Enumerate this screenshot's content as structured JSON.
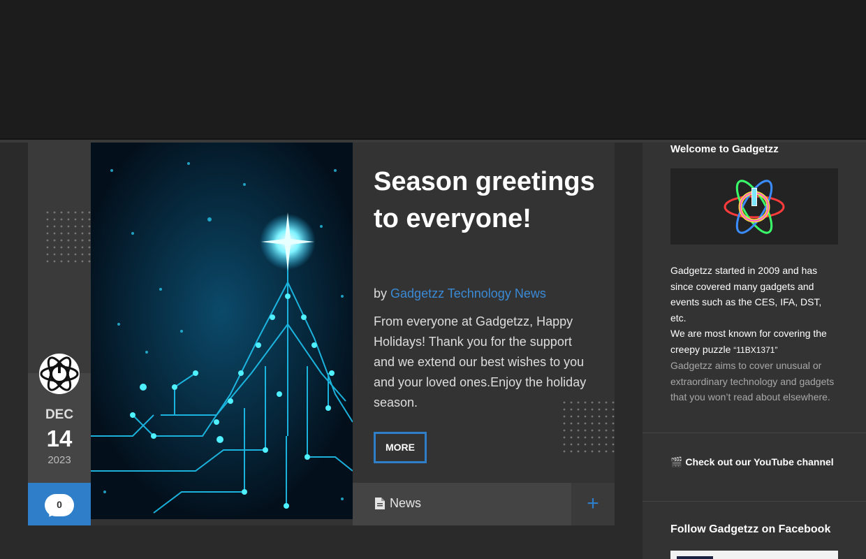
{
  "post": {
    "date": {
      "month": "DEC",
      "day": "14",
      "year": "2023"
    },
    "comment_count": "0",
    "title": "Season greetings to everyone!",
    "byline_prefix": "by",
    "author": "Gadgetzz Technology News",
    "excerpt": "From everyone at Gadgetzz, Happy Holidays! Thank you for the support and we extend our best wishes to you and your loved ones.Enjoy the holiday season.",
    "more_label": "MORE",
    "category": "News",
    "plus_label": "+",
    "icons": {
      "avatar": "power-atom-logo-icon",
      "comments": "speech-bubble-icon",
      "category": "document-icon",
      "expand": "plus-icon",
      "feature": "circuit-christmas-tree-image"
    }
  },
  "sidebar": {
    "welcome_title": "Welcome to Gadgetzz",
    "about_line1": "Gadgetzz started in 2009 and has since covered many gadgets and events such as the CES, IFA, DST, etc.",
    "about_line2": "We are most known for covering the creepy puzzle",
    "puzzle_name": "“11BX1371”",
    "about_line3": "Gadgetzz aims to cover unusual or extraordinary technology and gadgets that you won’t read about elsewhere.",
    "youtube_icon": "🎬",
    "youtube_label": "Check out our YouTube channel",
    "facebook_title": "Follow Gadgetzz on Facebook"
  },
  "colors": {
    "accent": "#2f7ec9",
    "background": "#2a2a2a",
    "header": "#1c1c1c",
    "panel": "#333333"
  }
}
